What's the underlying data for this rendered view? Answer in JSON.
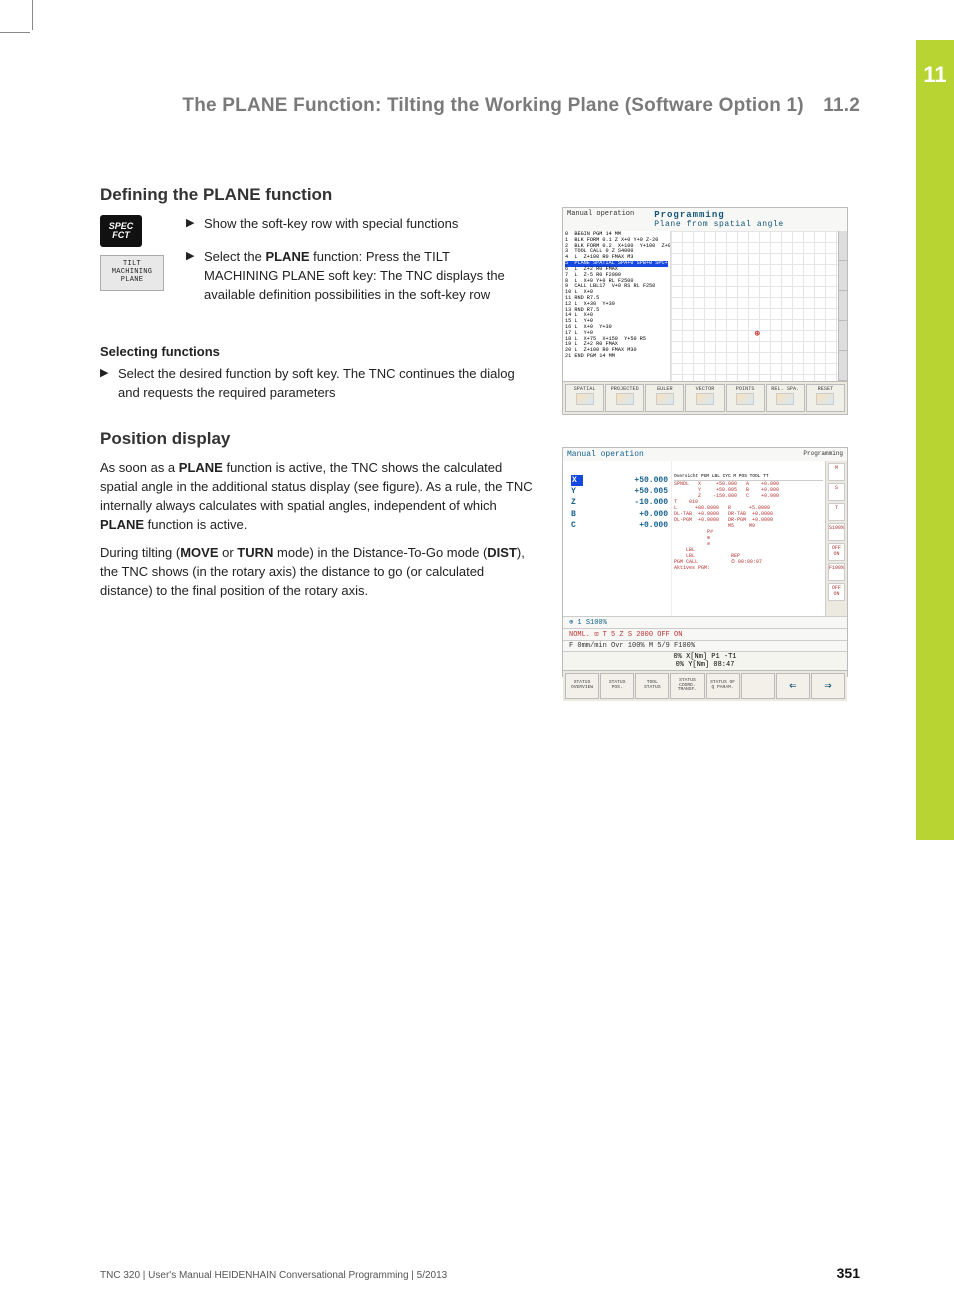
{
  "sidebar": {
    "chapter": "11"
  },
  "header": {
    "title": "The PLANE Function: Tilting the Working Plane (Software Option 1)",
    "section": "11.2"
  },
  "sec1": {
    "title": "Defining the PLANE function",
    "icon_spec_l1": "SPEC",
    "icon_spec_l2": "FCT",
    "icon_tilt_l1": "TILT",
    "icon_tilt_l2": "MACHINING",
    "icon_tilt_l3": "PLANE",
    "step1": "Show the soft-key row with special functions",
    "step2_pre": "Select the ",
    "step2_b": "PLANE",
    "step2_post": " function: Press the TILT MACHINING PLANE soft key: The TNC displays the available definition possibilities in the soft-key row"
  },
  "ss1": {
    "mode_left": "Manual operation",
    "mode_right": "Programming",
    "subtitle": "Plane from spatial angle",
    "code": "0  BEGIN PGM 14 MM\n1  BLK FORM 0.1 Z X+0 Y+0 Z-20\n2  BLK FORM 0.2  X+100  Y+100  Z+0\n3  TOOL CALL 0 Z S4000\n4  L  Z+100 R0 FMAX M3\n",
    "code_hl": "5  PLANE SPATIAL SPA+0 SPB+0 SPC+0 FMAX M128",
    "code2": "\n6  L  Z+2 R0 FMAX\n7  L  Z-5 R0 F2000\n8  L  X+0 Y+0 RL F2500\n9  CALL LBL17  V+0 RS RL F250\n10 L  X+0\n11 RND R7.5\n12 L  X+30  Y+30\n13 RND R7.5\n14 L  X+0\n15 L  Y+0\n16 L  X+0  Y+30\n17 L  Y+0\n18 L  X+75  X+150  Y+50 R5\n19 L  Z+2 R0 FMAX\n20 L  Z+100 R0 FMAX M30\n21 END PGM 14 MM",
    "softkeys": [
      "SPATIAL",
      "PROJECTED",
      "EULER",
      "VECTOR",
      "POINTS",
      "REL. SPA.",
      "RESET"
    ]
  },
  "sub1": {
    "title": "Selecting functions",
    "step": "Select the desired function by soft key. The TNC continues the dialog and requests the required parameters"
  },
  "sec2": {
    "title": "Position display",
    "p1_a": "As soon as a ",
    "p1_b1": "PLANE",
    "p1_b": " function is active, the TNC shows the calculated spatial angle in the additional status display (see figure). As a rule, the TNC internally always calculates with spatial angles, independent of which ",
    "p1_b2": "PLANE",
    "p1_c": " function is active.",
    "p2_a": "During tilting (",
    "p2_b1": "MOVE",
    "p2_b": " or ",
    "p2_b2": "TURN",
    "p2_c": " mode) in the Distance-To-Go mode (",
    "p2_b3": "DIST",
    "p2_d": "), the TNC shows (in the rotary axis) the distance to go (or calculated distance) to the final position of the rotary axis."
  },
  "ss2": {
    "mode": "Manual operation",
    "mode_r": "Programming",
    "axes": [
      {
        "ax": "X",
        "val": "+50.000"
      },
      {
        "ax": "Y",
        "val": "+50.005"
      },
      {
        "ax": "Z",
        "val": "-10.000"
      },
      {
        "ax": "B",
        "val": "+0.000"
      },
      {
        "ax": "C",
        "val": "+0.000"
      }
    ],
    "tabs": "Oversicht PGM LBL CYC M POS TOOL TT",
    "info_lines": [
      "SPNDL   X     +50.000   A    +0.000",
      "        Y     +50.005   B    +0.000",
      "        Z    -150.000   C    +0.000",
      "T    010",
      "L      +80.0000   R      +5.0000",
      "DL-TAB  +0.0000   DR-TAB  +0.0000",
      "DL-PGM  +0.0000   DR-PGM  +0.0000",
      "                  M5     M9",
      "           P#",
      "           ⊕",
      "           ⊘",
      "    LBL",
      "    LBL            REP",
      "PGM CALL           ⏱ 00:00:07",
      "Aktives PGM:"
    ],
    "bar": "⊕ 1                                     S100%",
    "bar2": "NOML. ⊡     T     5 Z S 2000            OFF  ON",
    "bar3": "F   0mm/min  Ovr 100%   M 5/9           F100%",
    "stat1": "0% X[Nm] P1  -T1",
    "stat2": "0% Y[Nm] 08:47",
    "softkeys": [
      "STATUS OVERVIEW",
      "STATUS POS.",
      "TOOL STATUS",
      "STATUS COORD. TRANSF.",
      "STATUS OF Q PARAM.",
      "",
      "⇐",
      "⇒"
    ],
    "right_icons": [
      "M",
      "S",
      "T",
      "S100%",
      "OFF ON",
      "F100%",
      "OFF ON"
    ]
  },
  "footer": {
    "text": "TNC 320 | User's Manual HEIDENHAIN Conversational Programming | 5/2013",
    "page": "351"
  }
}
